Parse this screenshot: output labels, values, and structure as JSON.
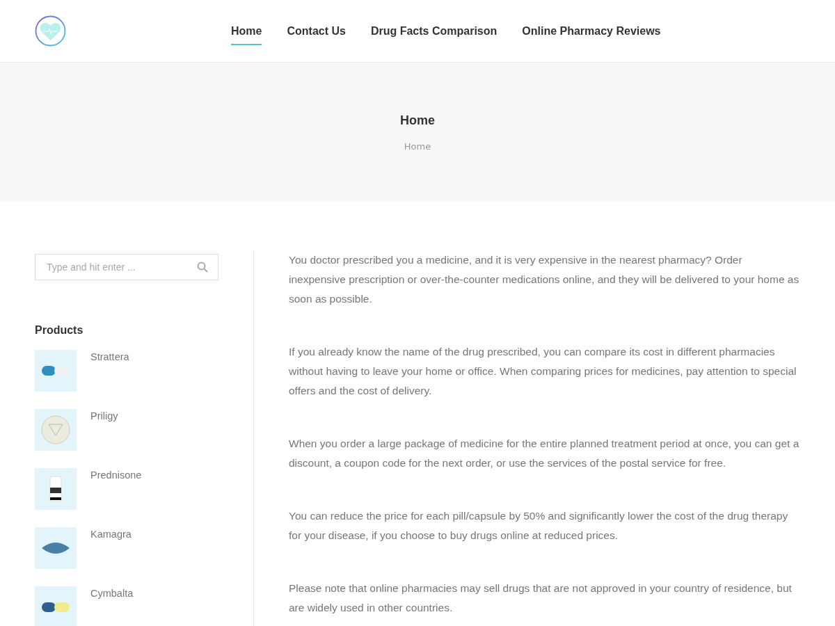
{
  "nav": [
    {
      "label": "Home",
      "selected": true
    },
    {
      "label": "Contact Us",
      "selected": false
    },
    {
      "label": "Drug Facts Comparison",
      "selected": false
    },
    {
      "label": "Online Pharmacy Reviews",
      "selected": false
    }
  ],
  "page_title": "Home",
  "breadcrumb": "Home",
  "search": {
    "placeholder": "Type and hit enter ..."
  },
  "products": {
    "title": "Products",
    "items": [
      {
        "name": "Strattera"
      },
      {
        "name": "Priligy"
      },
      {
        "name": "Prednisone"
      },
      {
        "name": "Kamagra"
      },
      {
        "name": "Cymbalta"
      }
    ]
  },
  "paragraphs": [
    "You doctor prescribed you a medicine, and it is very expensive in the nearest pharmacy? Order inexpensive prescription or over-the-counter medications online, and they will be delivered to your home as soon as possible.",
    "If you already know the name of the drug prescribed, you can compare its cost in different pharmacies without having to leave your home or office. When comparing prices for medicines, pay attention to special offers and the cost of delivery.",
    "When you order a large package of medicine for the entire planned treatment period at once, you can get a discount, a coupon code for the next order, or use the services of the postal service for free.",
    "You can reduce the price for each pill/capsule by 50% and significantly lower the cost of the drug therapy for your disease, if you choose to buy drugs online at reduced prices.",
    "Please note that online pharmacies may sell drugs that are not approved in your country of residence, but are widely used in other countries."
  ]
}
